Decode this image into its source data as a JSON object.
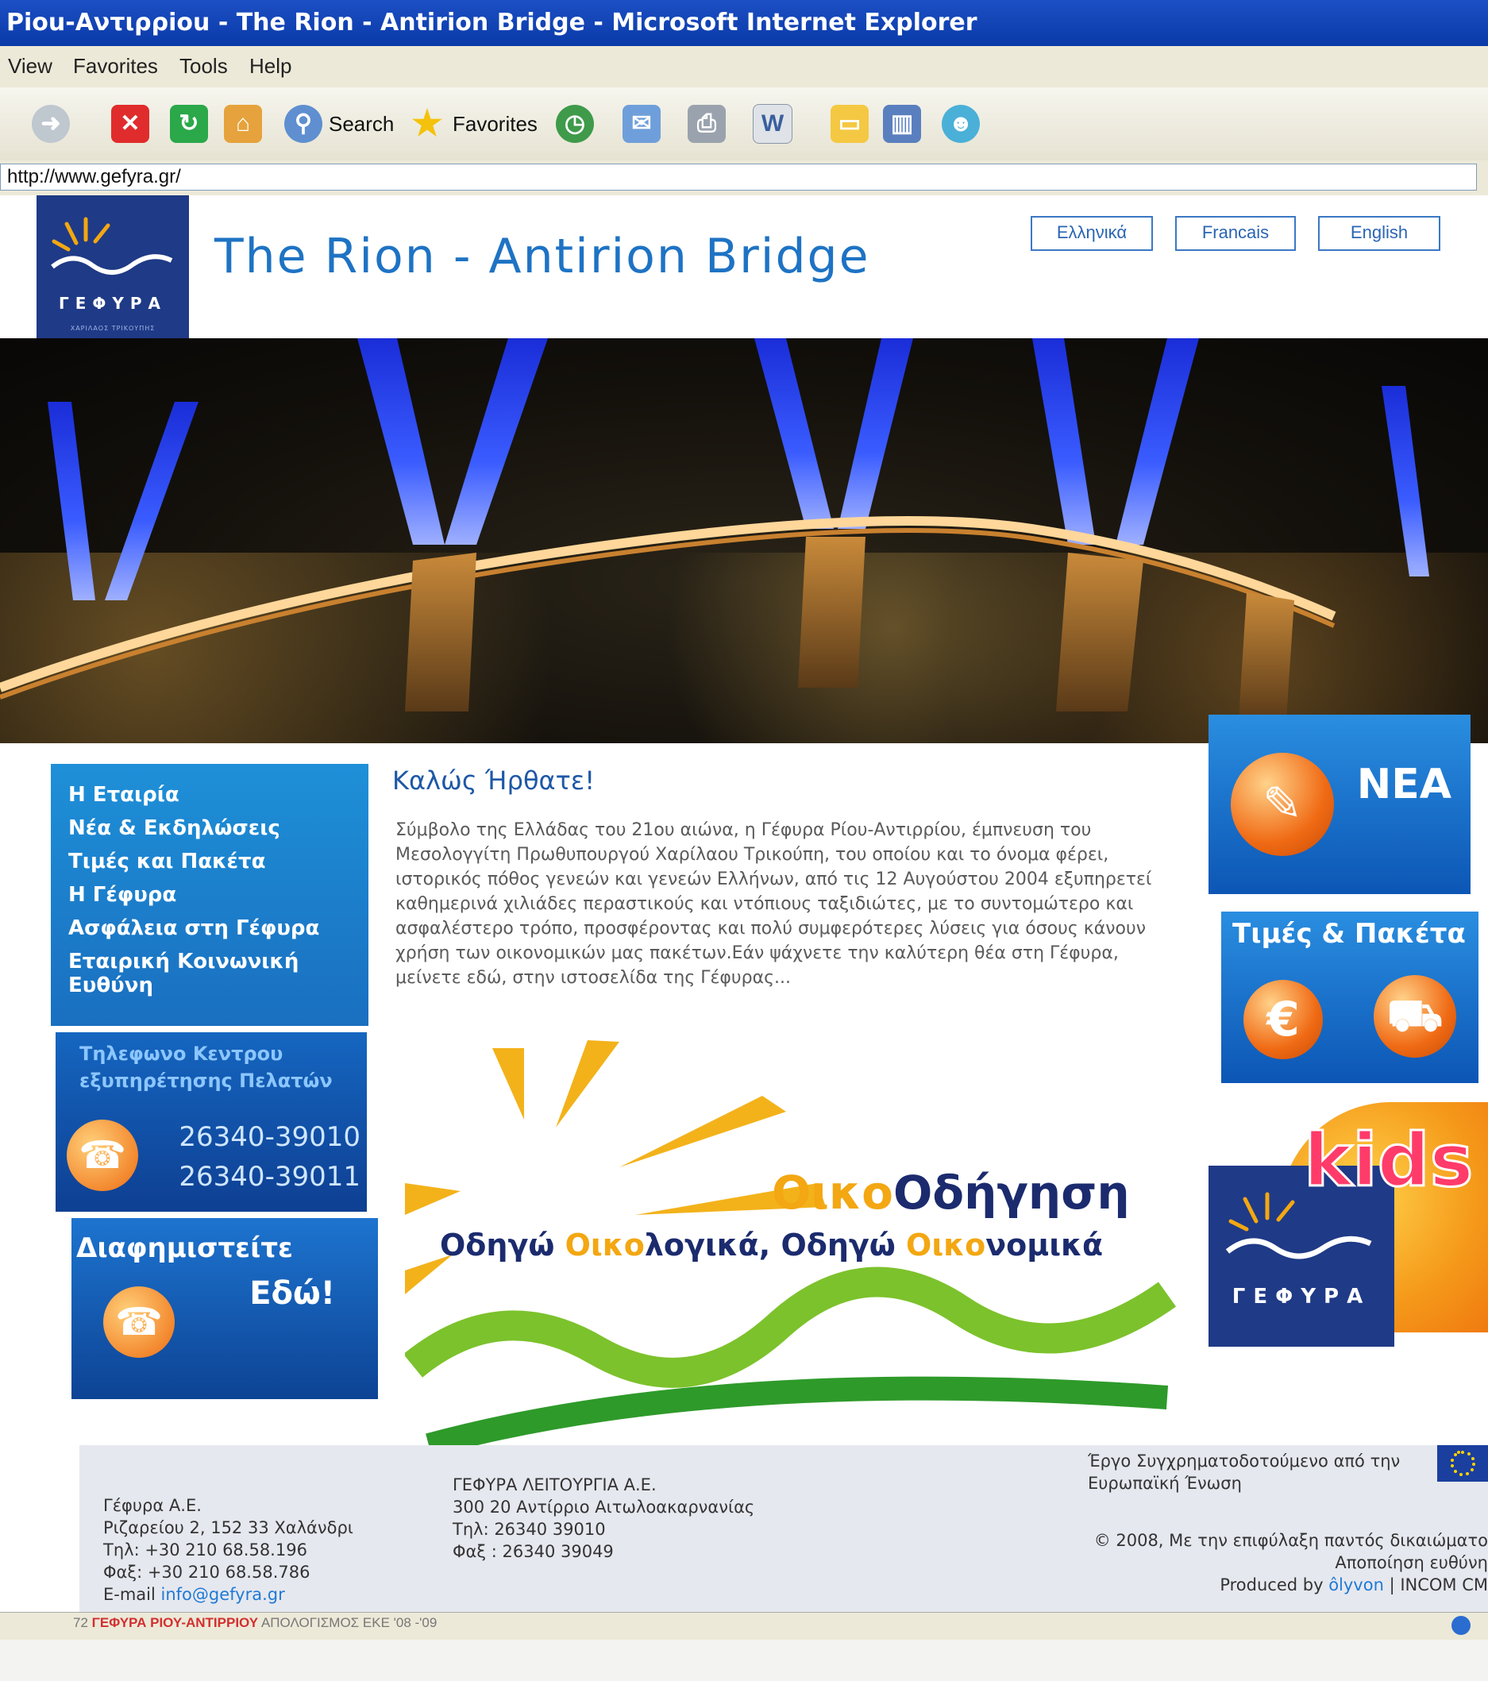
{
  "window": {
    "title": "Piou-Αντιρρiou - The Rion - Antirion Bridge - Microsoft Internet Explorer"
  },
  "menu": {
    "items": [
      "View",
      "Favorites",
      "Tools",
      "Help"
    ]
  },
  "toolbar": {
    "search_label": "Search",
    "favorites_label": "Favorites"
  },
  "address": {
    "url": "http://www.gefyra.gr/"
  },
  "site": {
    "logo_text": "ΓΕΦΥΡΑ",
    "logo_sub": "ΧΑΡΙΛΑΟΣ ΤΡΙΚΟΥΠΗΣ",
    "title": "The Rion - Antirion Bridge",
    "languages": [
      "Ελληνικά",
      "Francais",
      "English"
    ]
  },
  "leftnav": {
    "items": [
      "Η Εταιρία",
      "Νέα & Εκδηλώσεις",
      "Τιμές και Πακέτα",
      "Η Γέφυρα",
      "Ασφάλεια στη Γέφυρα",
      "Εταιρική Κοινωνική Ευθύνη"
    ]
  },
  "callcenter": {
    "title_line1": "Τηλεφωνο Κεντρου",
    "title_line2": "εξυπηρέτησης Πελατών",
    "numbers": [
      "26340-39010",
      "26340-39011"
    ]
  },
  "ad": {
    "line1": "Διαφημιστείτε",
    "line2": "Εδώ!"
  },
  "main": {
    "welcome": "Καλώς Ήρθατε!",
    "intro": "Σύμβολο της Ελλάδας του 21ου αιώνα, η Γέφυρα Ρίου-Αντιρρίου, έμπνευση του Μεσολογγίτη Πρωθυπουργού Χαρίλαου Τρικούπη, του οποίου και το όνομα φέρει, ιστορικός πόθος γενεών και γενεών Ελλήνων, από τις 12 Αυγούστου 2004 εξυπηρετεί καθημερινά χιλιάδες περαστικούς και ντόπιους ταξιδιώτες, με το συντομώτερο και ασφαλέστερο τρόπο, προσφέροντας και πολύ συμφερότερες λύσεις για όσους κάνουν χρήση των οικονομικών μας πακέτων.Εάν ψάχνετε την καλύτερη θέα στη Γέφυρα, μείνετε εδώ, στην ιστοσελίδα της Γέφυρας..."
  },
  "eco": {
    "title_prefix": "Οικο",
    "title_rest": "Οδήγηση",
    "sub_a": "Οδηγώ ",
    "sub_b": "Οικο",
    "sub_c": "λογικά, Οδηγώ ",
    "sub_d": "Οικο",
    "sub_e": "νομικά"
  },
  "right": {
    "nea": "ΝΕΑ",
    "prices": "Τιμές & Πακέτα",
    "kids": "kids"
  },
  "footer": {
    "col1": [
      "Γέφυρα Α.Ε.",
      "Ριζαρείου 2, 152 33 Χαλάνδρι",
      "Τηλ: +30 210 68.58.196",
      "Φαξ: +30 210 68.58.786"
    ],
    "email_label": "E-mail ",
    "email": "info@gefyra.gr",
    "col2": [
      "ΓΕΦΥΡΑ ΛΕΙΤΟΥΡΓΙΑ Α.Ε.",
      "300 20 Αντίρριο Αιτωλοακαρνανίας",
      "Τηλ: 26340 39010",
      "Φαξ : 26340 39049"
    ],
    "eu_line1": "Έργο Συγχρηματοδοτούμενο από την",
    "eu_line2": "Ευρωπαϊκή Ένωση",
    "copyright": "© 2008, Με την επιφύλαξη παντός δικαιώματο",
    "disclaimer": "Αποποίηση ευθύνη",
    "produced_prefix": "Produced by ",
    "produced_link": "ôlyvon",
    "produced_suffix": " | INCOM CM"
  },
  "caption": {
    "page": "72",
    "title": "ΓΕΦΥΡΑ ΡΙΟΥ-ΑΝΤΙΡΡΙΟΥ",
    "rest": "ΑΠΟΛΟΓΙΣΜΟΣ ΕΚΕ '08 -'09"
  },
  "colors": {
    "titlebar": "#0a3aa8",
    "site_blue": "#1e73c4",
    "nav_blue": "#1a6fc0",
    "orange": "#f06a14",
    "eco_yellow": "#f3a712",
    "eco_green": "#5bb224"
  }
}
